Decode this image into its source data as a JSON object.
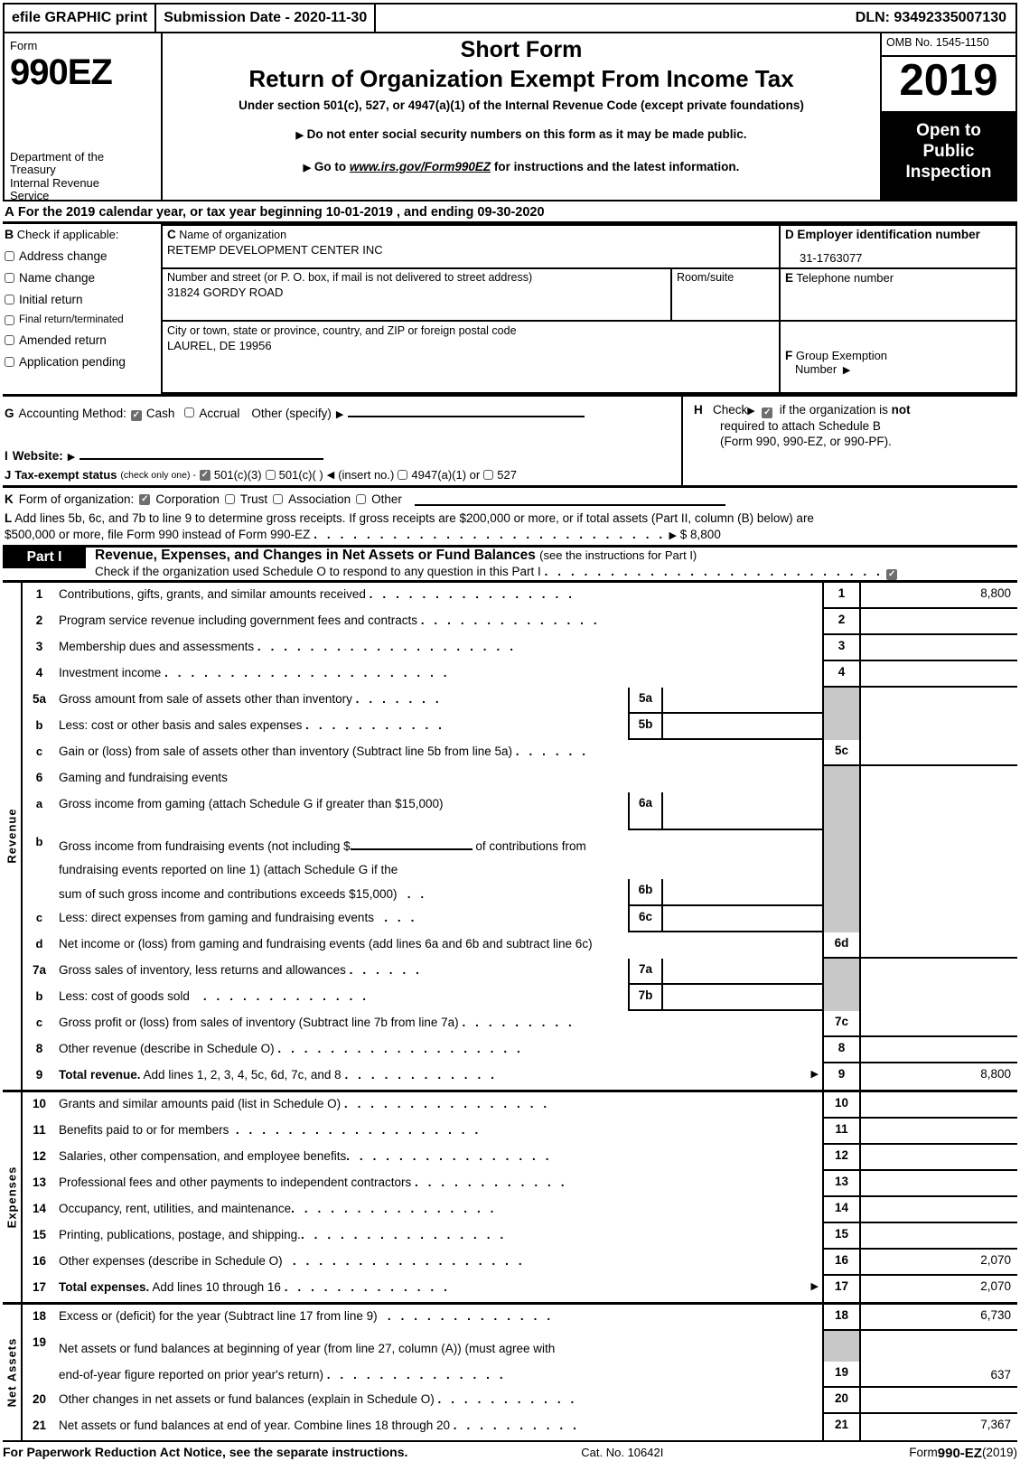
{
  "efile": {
    "graphic_print": "efile GRAPHIC print",
    "submission_date": "Submission Date - 2020-11-30",
    "dln": "DLN: 93492335007130"
  },
  "masthead": {
    "form_label": "Form",
    "form_number": "990EZ",
    "department": "Department of the Treasury Internal Revenue Service",
    "title_short": "Short Form",
    "title_main": "Return of Organization Exempt From Income Tax",
    "subtitle": "Under section 501(c), 527, or 4947(a)(1) of the Internal Revenue Code (except private foundations)",
    "bullet1": "Do not enter social security numbers on this form as it may be made public.",
    "bullet2_pre": "Go to ",
    "bullet2_link": "www.irs.gov/Form990EZ",
    "bullet2_post": " for instructions and the latest information.",
    "omb": "OMB No. 1545-1150",
    "year": "2019",
    "open_to": "Open to",
    "public": "Public",
    "inspection": "Inspection"
  },
  "line_a": {
    "letter": "A",
    "text": "For the 2019 calendar year, or tax year beginning 10-01-2019 , and ending 09-30-2020"
  },
  "section_b": {
    "letter": "B",
    "heading": "Check if applicable:",
    "items": [
      {
        "label": "Address change",
        "checked": false
      },
      {
        "label": "Name change",
        "checked": false
      },
      {
        "label": "Initial return",
        "checked": false
      },
      {
        "label": "Final return/terminated",
        "checked": false
      },
      {
        "label": "Amended return",
        "checked": false
      },
      {
        "label": "Application pending",
        "checked": false
      }
    ]
  },
  "section_c": {
    "letter": "C",
    "name_label": "Name of organization",
    "org_name": "RETEMP DEVELOPMENT CENTER INC",
    "street_label": "Number and street (or P. O. box, if mail is not delivered to street address)",
    "street_value": "31824 GORDY ROAD",
    "room_label": "Room/suite",
    "room_value": "",
    "city_label": "City or town, state or province, country, and ZIP or foreign postal code",
    "city_value": "LAUREL, DE   19956"
  },
  "section_d": {
    "letter": "D",
    "label": "Employer identification number",
    "value": "31-1763077"
  },
  "section_e": {
    "letter": "E",
    "label": "Telephone number",
    "value": ""
  },
  "section_f": {
    "letter": "F",
    "label_line1": "Group Exemption",
    "label_line2": "Number",
    "value": ""
  },
  "section_g": {
    "letter": "G",
    "label": "Accounting Method:",
    "cash": "Cash",
    "cash_checked": true,
    "accrual": "Accrual",
    "accrual_checked": false,
    "other": "Other (specify)",
    "other_value": ""
  },
  "section_h": {
    "letter": "H",
    "check_word": "Check",
    "checked": true,
    "text_1": "if the organization is ",
    "text_bold": "not",
    "line2": "required to attach Schedule B",
    "line3": "(Form 990, 990-EZ, or 990-PF)."
  },
  "section_i": {
    "letter": "I",
    "label": "Website:",
    "value": ""
  },
  "section_j": {
    "letter": "J",
    "label": "Tax-exempt status",
    "note": "(check only one) -",
    "options": [
      {
        "label": "501(c)(3)",
        "checked": true
      },
      {
        "label": "501(c)(   )",
        "checked": false
      },
      {
        "label": "(insert no.)",
        "checked": null
      },
      {
        "label": "4947(a)(1) or",
        "checked": false
      },
      {
        "label": "527",
        "checked": false
      }
    ]
  },
  "section_k": {
    "letter": "K",
    "label": "Form of organization:",
    "options": [
      {
        "label": "Corporation",
        "checked": true
      },
      {
        "label": "Trust",
        "checked": false
      },
      {
        "label": "Association",
        "checked": false
      },
      {
        "label": "Other",
        "checked": false
      }
    ],
    "other_value": ""
  },
  "section_l": {
    "letter": "L",
    "text_line1": "Add lines 5b, 6c, and 7b to line 9 to determine gross receipts. If gross receipts are $200,000 or more, or if total assets (Part II, column (B) below) are",
    "text_line2": "$500,000 or more, file Form 990 instead of Form 990-EZ",
    "amount": "$ 8,800"
  },
  "part1": {
    "label": "Part I",
    "title": "Revenue, Expenses, and Changes in Net Assets or Fund Balances",
    "title_note": "(see the instructions for Part I)",
    "schedule_o_text": "Check if the organization used Schedule O to respond to any question in this Part I",
    "schedule_o_checked": true,
    "side_labels": {
      "revenue": "Revenue",
      "expenses": "Expenses",
      "net_assets": "Net Assets"
    }
  },
  "revenue_rows": [
    {
      "no": "1",
      "desc": "Contributions, gifts, grants, and similar amounts received",
      "dots": 16,
      "numcol": "1",
      "amount": "8,800",
      "sub": null
    },
    {
      "no": "2",
      "desc": "Program service revenue including government fees and contracts",
      "dots": 14,
      "numcol": "2",
      "amount": "",
      "sub": null
    },
    {
      "no": "3",
      "desc": "Membership dues and assessments",
      "dots": 20,
      "numcol": "3",
      "amount": "",
      "sub": null
    },
    {
      "no": "4",
      "desc": "Investment income",
      "dots": 22,
      "numcol": "4",
      "amount": "",
      "sub": null
    },
    {
      "no": "5a",
      "desc": "Gross amount from sale of assets other than inventory",
      "dots": 7,
      "numcol": "",
      "amount": "",
      "sub": "5a",
      "sub_value": "",
      "gray": true
    },
    {
      "no": "b",
      "desc": "Less: cost or other basis and sales expenses",
      "dots": 11,
      "numcol": "",
      "amount": "",
      "sub": "5b",
      "sub_value": "",
      "gray": true
    },
    {
      "no": "c",
      "desc": "Gain or (loss) from sale of assets other than inventory (Subtract line 5b from line 5a)",
      "dots": 6,
      "numcol": "5c",
      "amount": "",
      "sub": null
    },
    {
      "no": "6",
      "desc": "Gaming and fundraising events",
      "dots": 0,
      "numcol": "",
      "amount": "",
      "sub": null,
      "gray": true
    },
    {
      "no": "a",
      "desc": "Gross income from gaming (attach Schedule G if greater than $15,000)",
      "dots": 0,
      "numcol": "",
      "amount": "",
      "sub": "6a",
      "sub_value": "",
      "gray": true
    },
    {
      "no": "b",
      "desc": "Gross income from fundraising events (not including $ ______ of contributions from fundraising events reported on line 1) (attach Schedule G if the sum of such gross income and contributions exceeds $15,000)",
      "dots": 2,
      "numcol": "",
      "amount": "",
      "sub": "6b",
      "sub_value": "",
      "gray": true
    },
    {
      "no": "c",
      "desc": "Less: direct expenses from gaming and fundraising events",
      "dots": 3,
      "numcol": "",
      "amount": "",
      "sub": "6c",
      "sub_value": "",
      "gray": true
    },
    {
      "no": "d",
      "desc": "Net income or (loss) from gaming and fundraising events (add lines 6a and 6b and subtract line 6c)",
      "dots": 0,
      "numcol": "6d",
      "amount": "",
      "sub": null
    },
    {
      "no": "7a",
      "desc": "Gross sales of inventory, less returns and allowances",
      "dots": 6,
      "numcol": "",
      "amount": "",
      "sub": "7a",
      "sub_value": "",
      "gray": true
    },
    {
      "no": "b",
      "desc": "Less: cost of goods sold",
      "dots": 13,
      "numcol": "",
      "amount": "",
      "sub": "7b",
      "sub_value": "",
      "gray": true
    },
    {
      "no": "c",
      "desc": "Gross profit or (loss) from sales of inventory (Subtract line 7b from line 7a)",
      "dots": 9,
      "numcol": "7c",
      "amount": "",
      "sub": null
    },
    {
      "no": "8",
      "desc": "Other revenue (describe in Schedule O)",
      "dots": 19,
      "numcol": "8",
      "amount": "",
      "sub": null
    },
    {
      "no": "9",
      "desc": "Total revenue. Add lines 1, 2, 3, 4, 5c, 6d, 7c, and 8",
      "dots": 12,
      "numcol": "9",
      "amount": "8,800",
      "sub": null,
      "bold_lead": "Total revenue.",
      "arrow": true
    }
  ],
  "expense_rows": [
    {
      "no": "10",
      "desc": "Grants and similar amounts paid (list in Schedule O)",
      "dots": 16,
      "numcol": "10",
      "amount": ""
    },
    {
      "no": "11",
      "desc": "Benefits paid to or for members",
      "dots": 19,
      "numcol": "11",
      "amount": ""
    },
    {
      "no": "12",
      "desc": "Salaries, other compensation, and employee benefits",
      "dots": 16,
      "numcol": "12",
      "amount": ""
    },
    {
      "no": "13",
      "desc": "Professional fees and other payments to independent contractors",
      "dots": 12,
      "numcol": "13",
      "amount": ""
    },
    {
      "no": "14",
      "desc": "Occupancy, rent, utilities, and maintenance",
      "dots": 16,
      "numcol": "14",
      "amount": ""
    },
    {
      "no": "15",
      "desc": "Printing, publications, postage, and shipping.",
      "dots": 16,
      "numcol": "15",
      "amount": ""
    },
    {
      "no": "16",
      "desc": "Other expenses (describe in Schedule O)",
      "dots": 18,
      "numcol": "16",
      "amount": "2,070"
    },
    {
      "no": "17",
      "desc": "Total expenses. Add lines 10 through 16",
      "dots": 13,
      "numcol": "17",
      "amount": "2,070",
      "bold_lead": "Total expenses.",
      "arrow": true
    }
  ],
  "net_asset_rows": [
    {
      "no": "18",
      "desc": "Excess or (deficit) for the year (Subtract line 17 from line 9)",
      "dots": 13,
      "numcol": "18",
      "amount": "6,730"
    },
    {
      "no": "19",
      "desc": "Net assets or fund balances at beginning of year (from line 27, column (A)) (must agree with",
      "desc2": "end-of-year figure reported on prior year's return)",
      "dots": 14,
      "numcol": "19",
      "amount": "637",
      "tall": true
    },
    {
      "no": "20",
      "desc": "Other changes in net assets or fund balances (explain in Schedule O)",
      "dots": 11,
      "numcol": "20",
      "amount": ""
    },
    {
      "no": "21",
      "desc": "Net assets or fund balances at end of year. Combine lines 18 through 20",
      "dots": 10,
      "numcol": "21",
      "amount": "7,367"
    }
  ],
  "footer": {
    "left": "For Paperwork Reduction Act Notice, see the separate instructions.",
    "center": "Cat. No. 10642I",
    "right_pre": "Form ",
    "right_bold": "990-EZ",
    "right_post": " (2019)"
  }
}
